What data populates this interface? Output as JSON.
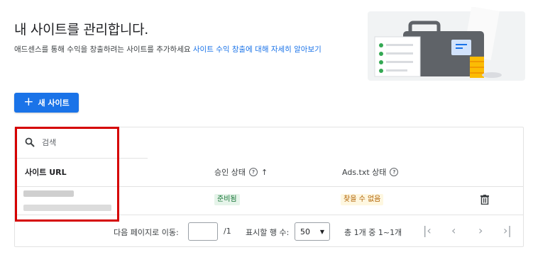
{
  "header": {
    "title": "내 사이트를 관리합니다.",
    "description": "애드센스를 통해 수익을 창출하려는 사이트를 추가하세요 ",
    "learn_more_link": "사이트 수익 창출에 대해 자세히 알아보기"
  },
  "toolbar": {
    "new_site_label": "새 사이트"
  },
  "table": {
    "search_placeholder": "검색",
    "columns": {
      "url": "사이트 URL",
      "approval": "승인 상태",
      "ads_txt": "Ads.txt 상태"
    },
    "rows": [
      {
        "approval_status": "준비됨",
        "ads_txt_status": "찾을 수 없음"
      }
    ]
  },
  "pagination": {
    "goto_label": "다음 페이지로 이동:",
    "page_value": "",
    "total_pages": "/1",
    "rows_label": "표시할 행 수:",
    "rows_per_page": "50",
    "range_label": "총 1개 중 1~1개"
  },
  "colors": {
    "accent": "#1a73e8",
    "ready_bg": "#e6f4ea",
    "notfound_bg": "#fef7e0",
    "annotation": "#d50000"
  }
}
